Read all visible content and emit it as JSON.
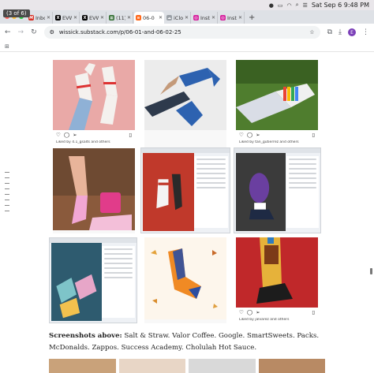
{
  "counter": "(3 of 6)",
  "menubar": {
    "datetime": "Sat Sep 6  9:48 PM"
  },
  "tabs": [
    {
      "label": "Inbox",
      "icon": "gmail-icon",
      "color": "#d93025",
      "glyph": "M",
      "active": false
    },
    {
      "label": "EVW",
      "icon": "x-icon",
      "color": "#000000",
      "glyph": "X",
      "active": false
    },
    {
      "label": "EVW",
      "icon": "x-icon",
      "color": "#000000",
      "glyph": "X",
      "active": false
    },
    {
      "label": "(11) L",
      "icon": "app-icon",
      "color": "#2f6b2f",
      "glyph": "▦",
      "active": false
    },
    {
      "label": "06-0",
      "icon": "substack-icon",
      "color": "#ff6719",
      "glyph": "≡",
      "active": true
    },
    {
      "label": "iClou",
      "icon": "icloud-icon",
      "color": "#9aa0a6",
      "glyph": "☁",
      "active": false
    },
    {
      "label": "Insta",
      "icon": "instagram-icon",
      "color": "#d6249f",
      "glyph": "◎",
      "active": false
    },
    {
      "label": "Insta",
      "icon": "instagram-icon",
      "color": "#d6249f",
      "glyph": "◎",
      "active": false
    }
  ],
  "address": {
    "url": "wissick.substack.com/p/06-01-and-06-02-25",
    "profile_initial": "E"
  },
  "tiles": [
    {
      "name": "tile-socks-salt-straw",
      "liked": "Liked by 4.1_gsalts and others"
    },
    {
      "name": "tile-socks-valor-coffee",
      "liked": ""
    },
    {
      "name": "tile-socks-google",
      "liked": "Liked by tan_gutierrez and others"
    },
    {
      "name": "tile-socks-smartsweets",
      "liked": ""
    },
    {
      "name": "tile-socks-packs",
      "liked": ""
    },
    {
      "name": "tile-socks-mcdonalds",
      "liked": ""
    },
    {
      "name": "tile-socks-zappos",
      "liked": ""
    },
    {
      "name": "tile-socks-success-academy",
      "liked": ""
    },
    {
      "name": "tile-socks-cholulah",
      "liked": "Liked by jalvarez and others"
    }
  ],
  "caption": {
    "lead": "Screenshots above:",
    "text": " Salt & Straw. Valor Coffee. Google. SmartSweets. Packs. McDonalds. Zappos. Success Academy. Cholulah Hot Sauce."
  },
  "colors": {
    "accent": "#ff6719",
    "profile": "#7b3fb8"
  }
}
